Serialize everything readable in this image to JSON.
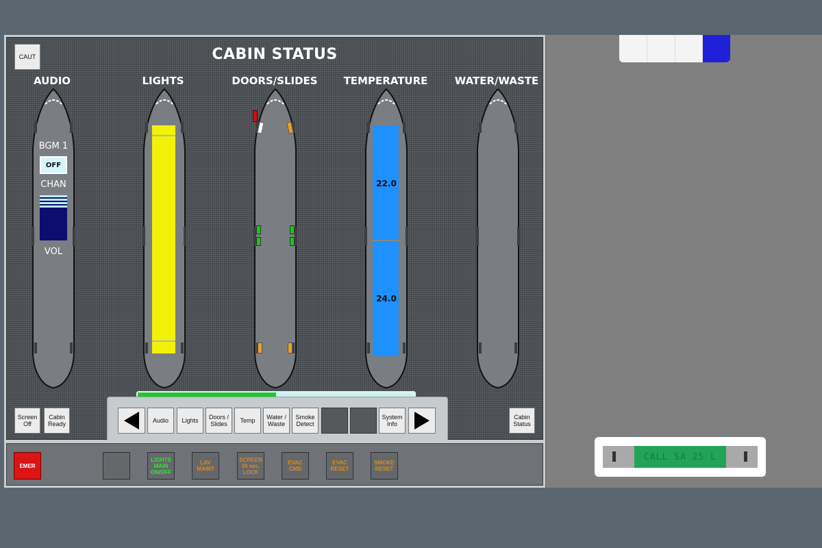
{
  "screen": {
    "title": "CABIN STATUS",
    "caut_button": "CAUT",
    "panels": [
      "AUDIO",
      "LIGHTS",
      "DOORS/SLIDES",
      "TEMPERATURE",
      "WATER/WASTE"
    ]
  },
  "audio": {
    "bgm_label": "BGM 1",
    "off_button": "OFF",
    "chan_label": "CHAN",
    "vol_label": "VOL"
  },
  "temperature": {
    "zone_fwd": "22.0",
    "zone_aft": "24.0",
    "color": "#1e90ff"
  },
  "lights": {
    "color": "#f1f10a"
  },
  "left_buttons": {
    "screen_off": "Screen Off",
    "cabin_ready": "Cabin Ready"
  },
  "right_buttons": {
    "cabin_status": "Cabin Status"
  },
  "nav": {
    "progress": 0.5,
    "items": [
      "Audio",
      "Lights",
      "Doors / Slides",
      "Temp",
      "Water / Waste",
      "Smoke Detect",
      "",
      "",
      "System Info"
    ]
  },
  "bottom": {
    "emer": "EMER",
    "lights_main": "LIGHTS MAIN ON/OFF",
    "lav_maint": "LAV MAINT",
    "screen_lock": "SCREEN 30 sec. LOCK",
    "evac_cmd": "EVAC CMD",
    "evac_reset": "EVAC RESET",
    "smoke_reset": "SMOKE RESET",
    "colors": {
      "green": "#32e632",
      "amber": "#d98a1c",
      "red": "#d91515"
    }
  },
  "call_display": {
    "text": "CALL SA 25 L"
  }
}
